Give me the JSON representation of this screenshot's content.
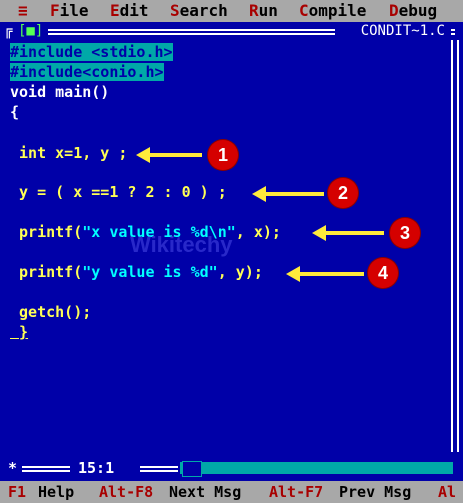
{
  "menu": {
    "system": "≡",
    "file": {
      "hot": "F",
      "rest": "ile"
    },
    "edit": {
      "hot": "E",
      "rest": "dit"
    },
    "search": {
      "hot": "S",
      "rest": "earch"
    },
    "run": {
      "hot": "R",
      "rest": "un"
    },
    "compile": {
      "hot": "C",
      "rest": "ompile"
    },
    "debug": {
      "hot": "D",
      "rest": "ebug"
    }
  },
  "window": {
    "corner": "╔",
    "close_box": "[■]",
    "title": "CONDIT~1.C"
  },
  "code": {
    "l1": "#include <stdio.h>",
    "l2": "#include<conio.h>",
    "l3": "void main()",
    "l4": "{",
    "l5": " int x=1, y ;",
    "l6": " y = ( x ==1 ? 2 : 0 ) ;",
    "l7a": " printf(",
    "l7b": "\"x value is %d\\n\"",
    "l7c": ", x);",
    "l8a": " printf(",
    "l8b": "\"y value is %d\"",
    "l8c": ", y);",
    "l9": " getch();",
    "l10": " }"
  },
  "watermark": "Wikitechy",
  "annotations": [
    "1",
    "2",
    "3",
    "4"
  ],
  "bottom_frame": {
    "star": "*",
    "position": "15:1"
  },
  "status": {
    "f1_key": "F1",
    "f1_label": "Help",
    "altf8_key": "Alt-F8",
    "altf8_label": "Next Msg",
    "altf7_key": "Alt-F7",
    "altf7_label": "Prev Msg",
    "alt_key": "Al"
  }
}
